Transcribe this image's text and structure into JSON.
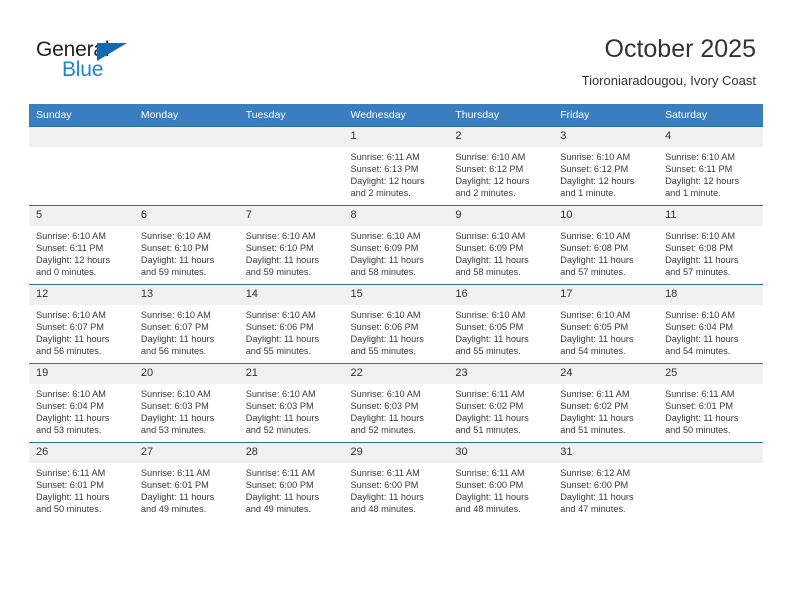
{
  "brand": {
    "name_top": "General",
    "name_bottom": "Blue",
    "triangle_color": "#1268b3",
    "blue_color": "#1c84d6"
  },
  "header": {
    "title": "October 2025",
    "subtitle": "Tioroniaradougou, Ivory Coast"
  },
  "theme": {
    "header_row_bg": "#3a7dc0",
    "daynum_bg": "#f0f0f0",
    "cell_border": "#2c6fae"
  },
  "calendar": {
    "weekday_headers": [
      "Sunday",
      "Monday",
      "Tuesday",
      "Wednesday",
      "Thursday",
      "Friday",
      "Saturday"
    ],
    "weeks": [
      [
        {
          "day": "",
          "sunrise": "",
          "sunset": "",
          "daylight": "",
          "daylight2": ""
        },
        {
          "day": "",
          "sunrise": "",
          "sunset": "",
          "daylight": "",
          "daylight2": ""
        },
        {
          "day": "",
          "sunrise": "",
          "sunset": "",
          "daylight": "",
          "daylight2": ""
        },
        {
          "day": "1",
          "sunrise": "Sunrise: 6:11 AM",
          "sunset": "Sunset: 6:13 PM",
          "daylight": "Daylight: 12 hours",
          "daylight2": "and 2 minutes."
        },
        {
          "day": "2",
          "sunrise": "Sunrise: 6:10 AM",
          "sunset": "Sunset: 6:12 PM",
          "daylight": "Daylight: 12 hours",
          "daylight2": "and 2 minutes."
        },
        {
          "day": "3",
          "sunrise": "Sunrise: 6:10 AM",
          "sunset": "Sunset: 6:12 PM",
          "daylight": "Daylight: 12 hours",
          "daylight2": "and 1 minute."
        },
        {
          "day": "4",
          "sunrise": "Sunrise: 6:10 AM",
          "sunset": "Sunset: 6:11 PM",
          "daylight": "Daylight: 12 hours",
          "daylight2": "and 1 minute."
        }
      ],
      [
        {
          "day": "5",
          "sunrise": "Sunrise: 6:10 AM",
          "sunset": "Sunset: 6:11 PM",
          "daylight": "Daylight: 12 hours",
          "daylight2": "and 0 minutes."
        },
        {
          "day": "6",
          "sunrise": "Sunrise: 6:10 AM",
          "sunset": "Sunset: 6:10 PM",
          "daylight": "Daylight: 11 hours",
          "daylight2": "and 59 minutes."
        },
        {
          "day": "7",
          "sunrise": "Sunrise: 6:10 AM",
          "sunset": "Sunset: 6:10 PM",
          "daylight": "Daylight: 11 hours",
          "daylight2": "and 59 minutes."
        },
        {
          "day": "8",
          "sunrise": "Sunrise: 6:10 AM",
          "sunset": "Sunset: 6:09 PM",
          "daylight": "Daylight: 11 hours",
          "daylight2": "and 58 minutes."
        },
        {
          "day": "9",
          "sunrise": "Sunrise: 6:10 AM",
          "sunset": "Sunset: 6:09 PM",
          "daylight": "Daylight: 11 hours",
          "daylight2": "and 58 minutes."
        },
        {
          "day": "10",
          "sunrise": "Sunrise: 6:10 AM",
          "sunset": "Sunset: 6:08 PM",
          "daylight": "Daylight: 11 hours",
          "daylight2": "and 57 minutes."
        },
        {
          "day": "11",
          "sunrise": "Sunrise: 6:10 AM",
          "sunset": "Sunset: 6:08 PM",
          "daylight": "Daylight: 11 hours",
          "daylight2": "and 57 minutes."
        }
      ],
      [
        {
          "day": "12",
          "sunrise": "Sunrise: 6:10 AM",
          "sunset": "Sunset: 6:07 PM",
          "daylight": "Daylight: 11 hours",
          "daylight2": "and 56 minutes."
        },
        {
          "day": "13",
          "sunrise": "Sunrise: 6:10 AM",
          "sunset": "Sunset: 6:07 PM",
          "daylight": "Daylight: 11 hours",
          "daylight2": "and 56 minutes."
        },
        {
          "day": "14",
          "sunrise": "Sunrise: 6:10 AM",
          "sunset": "Sunset: 6:06 PM",
          "daylight": "Daylight: 11 hours",
          "daylight2": "and 55 minutes."
        },
        {
          "day": "15",
          "sunrise": "Sunrise: 6:10 AM",
          "sunset": "Sunset: 6:06 PM",
          "daylight": "Daylight: 11 hours",
          "daylight2": "and 55 minutes."
        },
        {
          "day": "16",
          "sunrise": "Sunrise: 6:10 AM",
          "sunset": "Sunset: 6:05 PM",
          "daylight": "Daylight: 11 hours",
          "daylight2": "and 55 minutes."
        },
        {
          "day": "17",
          "sunrise": "Sunrise: 6:10 AM",
          "sunset": "Sunset: 6:05 PM",
          "daylight": "Daylight: 11 hours",
          "daylight2": "and 54 minutes."
        },
        {
          "day": "18",
          "sunrise": "Sunrise: 6:10 AM",
          "sunset": "Sunset: 6:04 PM",
          "daylight": "Daylight: 11 hours",
          "daylight2": "and 54 minutes."
        }
      ],
      [
        {
          "day": "19",
          "sunrise": "Sunrise: 6:10 AM",
          "sunset": "Sunset: 6:04 PM",
          "daylight": "Daylight: 11 hours",
          "daylight2": "and 53 minutes."
        },
        {
          "day": "20",
          "sunrise": "Sunrise: 6:10 AM",
          "sunset": "Sunset: 6:03 PM",
          "daylight": "Daylight: 11 hours",
          "daylight2": "and 53 minutes."
        },
        {
          "day": "21",
          "sunrise": "Sunrise: 6:10 AM",
          "sunset": "Sunset: 6:03 PM",
          "daylight": "Daylight: 11 hours",
          "daylight2": "and 52 minutes."
        },
        {
          "day": "22",
          "sunrise": "Sunrise: 6:10 AM",
          "sunset": "Sunset: 6:03 PM",
          "daylight": "Daylight: 11 hours",
          "daylight2": "and 52 minutes."
        },
        {
          "day": "23",
          "sunrise": "Sunrise: 6:11 AM",
          "sunset": "Sunset: 6:02 PM",
          "daylight": "Daylight: 11 hours",
          "daylight2": "and 51 minutes."
        },
        {
          "day": "24",
          "sunrise": "Sunrise: 6:11 AM",
          "sunset": "Sunset: 6:02 PM",
          "daylight": "Daylight: 11 hours",
          "daylight2": "and 51 minutes."
        },
        {
          "day": "25",
          "sunrise": "Sunrise: 6:11 AM",
          "sunset": "Sunset: 6:01 PM",
          "daylight": "Daylight: 11 hours",
          "daylight2": "and 50 minutes."
        }
      ],
      [
        {
          "day": "26",
          "sunrise": "Sunrise: 6:11 AM",
          "sunset": "Sunset: 6:01 PM",
          "daylight": "Daylight: 11 hours",
          "daylight2": "and 50 minutes."
        },
        {
          "day": "27",
          "sunrise": "Sunrise: 6:11 AM",
          "sunset": "Sunset: 6:01 PM",
          "daylight": "Daylight: 11 hours",
          "daylight2": "and 49 minutes."
        },
        {
          "day": "28",
          "sunrise": "Sunrise: 6:11 AM",
          "sunset": "Sunset: 6:00 PM",
          "daylight": "Daylight: 11 hours",
          "daylight2": "and 49 minutes."
        },
        {
          "day": "29",
          "sunrise": "Sunrise: 6:11 AM",
          "sunset": "Sunset: 6:00 PM",
          "daylight": "Daylight: 11 hours",
          "daylight2": "and 48 minutes."
        },
        {
          "day": "30",
          "sunrise": "Sunrise: 6:11 AM",
          "sunset": "Sunset: 6:00 PM",
          "daylight": "Daylight: 11 hours",
          "daylight2": "and 48 minutes."
        },
        {
          "day": "31",
          "sunrise": "Sunrise: 6:12 AM",
          "sunset": "Sunset: 6:00 PM",
          "daylight": "Daylight: 11 hours",
          "daylight2": "and 47 minutes."
        },
        {
          "day": "",
          "sunrise": "",
          "sunset": "",
          "daylight": "",
          "daylight2": ""
        }
      ]
    ]
  }
}
